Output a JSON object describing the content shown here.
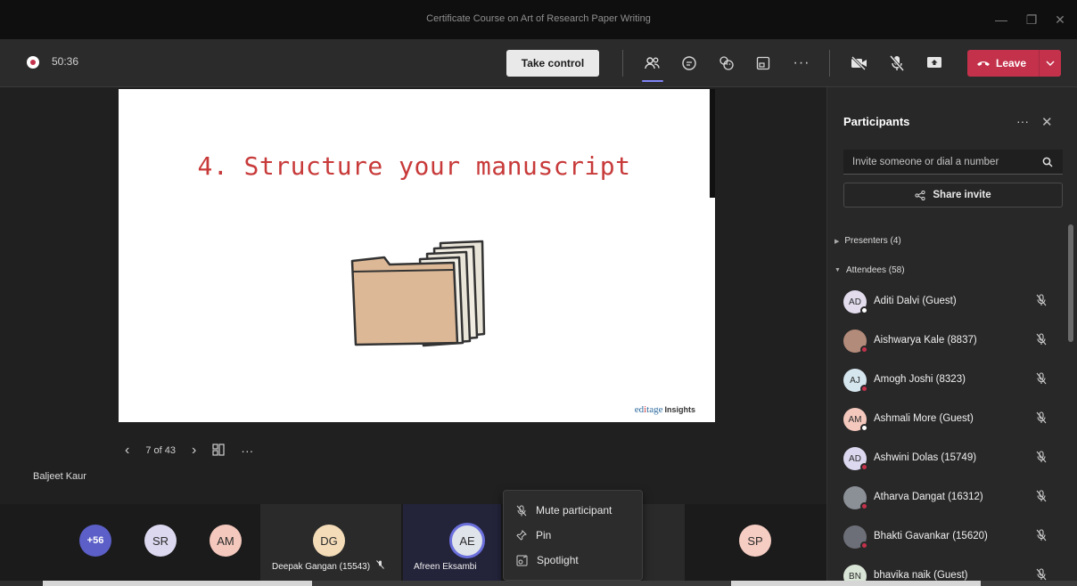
{
  "window": {
    "title": "Certificate Course on Art of Research Paper Writing"
  },
  "toolbar": {
    "timer": "50:36",
    "take_control": "Take control",
    "leave": "Leave"
  },
  "slide": {
    "title": "4. Structure your manuscript",
    "brand_prefix": "ed",
    "brand_i": "i",
    "brand_suffix": "tage",
    "brand_insights": "Insights",
    "counter": "7 of 43",
    "presenter": "Baljeet Kaur"
  },
  "strip": {
    "overflow": "+56",
    "avatars": [
      "SR",
      "AM"
    ],
    "tile1": {
      "initials": "DG",
      "name": "Deepak Gangan (15543)"
    },
    "tile2": {
      "initials": "AE",
      "name": "Afreen Eksambi"
    },
    "last": "SP"
  },
  "context_menu": {
    "items": [
      "Mute participant",
      "Pin",
      "Spotlight"
    ]
  },
  "panel": {
    "title": "Participants",
    "invite_placeholder": "Invite someone or dial a number",
    "share_invite": "Share invite",
    "presenters": "Presenters (4)",
    "attendees": "Attendees (58)",
    "participants": [
      {
        "initials": "AD",
        "name": "Aditi Dalvi (Guest)"
      },
      {
        "initials": "",
        "name": "Aishwarya Kale (8837)"
      },
      {
        "initials": "AJ",
        "name": "Amogh Joshi (8323)"
      },
      {
        "initials": "AM",
        "name": "Ashmali More (Guest)"
      },
      {
        "initials": "AD",
        "name": "Ashwini Dolas (15749)"
      },
      {
        "initials": "",
        "name": "Atharva Dangat (16312)"
      },
      {
        "initials": "",
        "name": "Bhakti Gavankar (15620)"
      },
      {
        "initials": "BN",
        "name": "bhavika naik (Guest)"
      }
    ]
  },
  "colors": {
    "accent": "#7f85f5",
    "leave": "#c4314b",
    "slide_title": "#c83a3a"
  }
}
